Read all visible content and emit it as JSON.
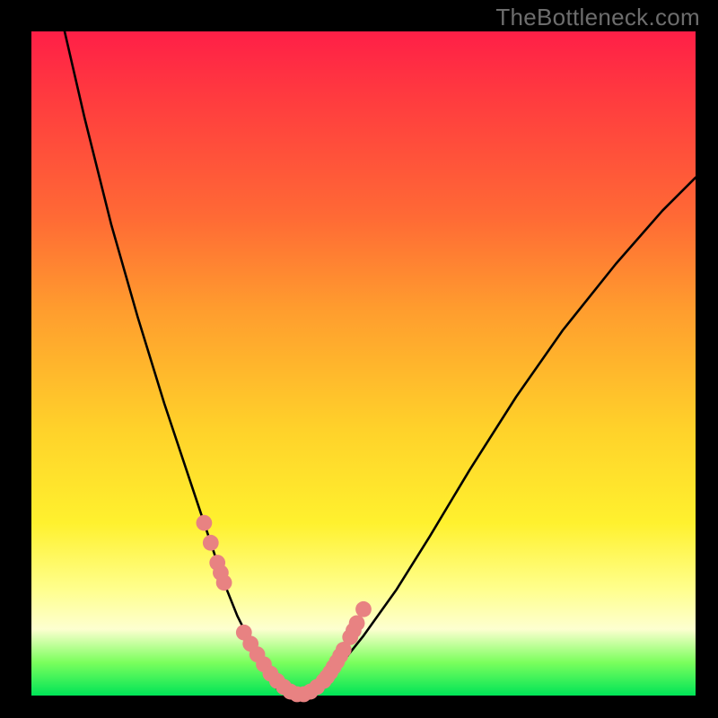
{
  "watermark": "TheBottleneck.com",
  "chart_data": {
    "type": "line",
    "title": "",
    "xlabel": "",
    "ylabel": "",
    "xlim": [
      0,
      100
    ],
    "ylim": [
      0,
      100
    ],
    "grid": false,
    "legend": false,
    "series": [
      {
        "name": "curve",
        "color": "#000000",
        "x": [
          5,
          8,
          12,
          16,
          20,
          24,
          27,
          29,
          31,
          33,
          35,
          37,
          39,
          41,
          43,
          46,
          50,
          55,
          60,
          66,
          73,
          80,
          88,
          95,
          100
        ],
        "y": [
          100,
          87,
          71,
          57,
          44,
          32,
          23,
          17,
          12,
          8,
          4,
          1,
          0,
          0,
          1,
          4,
          9,
          16,
          24,
          34,
          45,
          55,
          65,
          73,
          78
        ]
      }
    ],
    "markers": {
      "name": "highlight-points",
      "color": "#e88282",
      "radius": 1.2,
      "x": [
        26,
        27,
        28,
        28.5,
        29,
        32,
        33,
        34,
        35,
        36,
        37,
        38,
        39,
        40,
        41,
        42,
        43,
        44,
        44.5,
        45,
        45.5,
        46,
        46.5,
        47,
        48,
        48.5,
        49,
        50
      ],
      "y": [
        26,
        23,
        20,
        18.5,
        17,
        9.5,
        7.8,
        6.2,
        4.7,
        3.3,
        2.2,
        1.3,
        0.6,
        0.2,
        0.2,
        0.6,
        1.3,
        2.2,
        2.8,
        3.5,
        4.3,
        5.1,
        6.0,
        6.9,
        8.8,
        9.8,
        10.9,
        13.0
      ]
    },
    "gradient_stops": [
      {
        "pos": 0,
        "color": "#ff1f47"
      },
      {
        "pos": 28,
        "color": "#ff6a35"
      },
      {
        "pos": 60,
        "color": "#ffd22a"
      },
      {
        "pos": 90,
        "color": "#fdffd0"
      },
      {
        "pos": 100,
        "color": "#00e457"
      }
    ]
  }
}
